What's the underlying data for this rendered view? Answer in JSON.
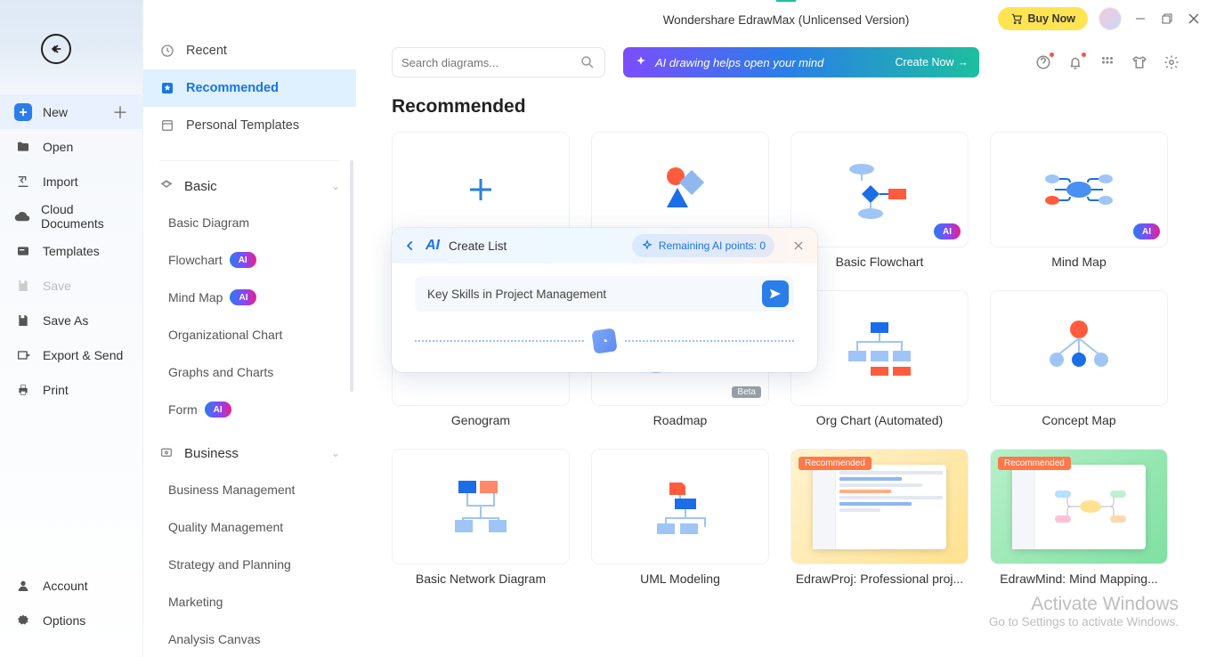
{
  "app_title": "Wondershare EdrawMax (Unlicensed Version)",
  "buy_now": "Buy Now",
  "search_placeholder": "Search diagrams...",
  "banner_text": "AI drawing helps open your mind",
  "banner_cta": "Create Now",
  "section_title": "Recommended",
  "col1": {
    "new": "New",
    "open": "Open",
    "import": "Import",
    "cloud": "Cloud Documents",
    "templates": "Templates",
    "save": "Save",
    "save_as": "Save As",
    "export": "Export & Send",
    "print": "Print",
    "account": "Account",
    "options": "Options"
  },
  "col2": {
    "recent": "Recent",
    "recommended": "Recommended",
    "personal": "Personal Templates",
    "basic": "Basic",
    "basic_items": {
      "basic_diagram": "Basic Diagram",
      "flowchart": "Flowchart",
      "mind_map": "Mind Map",
      "org_chart": "Organizational Chart",
      "graphs": "Graphs and Charts",
      "form": "Form"
    },
    "business": "Business",
    "business_items": {
      "biz_mgmt": "Business Management",
      "quality": "Quality Management",
      "strategy": "Strategy and Planning",
      "marketing": "Marketing",
      "analysis": "Analysis Canvas"
    }
  },
  "templates": {
    "blank": "",
    "basic_shapes": "",
    "basic_flowchart": "Basic Flowchart",
    "mind_map": "Mind Map",
    "genogram": "Genogram",
    "roadmap": "Roadmap",
    "org_auto": "Org Chart (Automated)",
    "concept": "Concept Map",
    "basic_network": "Basic Network Diagram",
    "uml": "UML Modeling",
    "edrawproj": "EdrawProj: Professional proj...",
    "edrawmind": "EdrawMind: Mind Mapping..."
  },
  "badges": {
    "ai": "AI",
    "beta": "Beta",
    "recommended": "Recommended"
  },
  "ai_popup": {
    "title": "Create List",
    "points": "Remaining AI points: 0",
    "placeholder": "Key Skills in Project Management"
  },
  "watermark": {
    "l1": "Activate Windows",
    "l2": "Go to Settings to activate Windows."
  }
}
